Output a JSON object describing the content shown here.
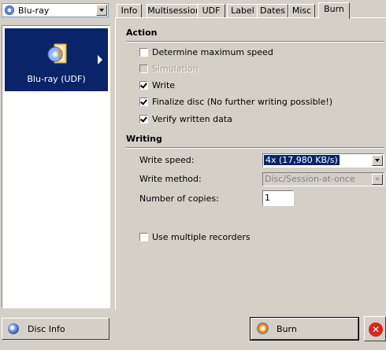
{
  "media": {
    "selected": "Blu-ray"
  },
  "compilation": {
    "item_label": "Blu-ray (UDF)"
  },
  "tabs": [
    {
      "label": "Info"
    },
    {
      "label": "Multisession"
    },
    {
      "label": "UDF"
    },
    {
      "label": "Label"
    },
    {
      "label": "Dates"
    },
    {
      "label": "Misc"
    },
    {
      "label": "Burn"
    }
  ],
  "active_tab": "Burn",
  "action": {
    "title": "Action",
    "options": [
      {
        "label": "Determine maximum speed",
        "checked": false,
        "enabled": true
      },
      {
        "label": "Simulation",
        "checked": false,
        "enabled": false
      },
      {
        "label": "Write",
        "checked": true,
        "enabled": true
      },
      {
        "label": "Finalize disc (No further writing possible!)",
        "checked": true,
        "enabled": true
      },
      {
        "label": "Verify written data",
        "checked": true,
        "enabled": true
      }
    ]
  },
  "writing": {
    "title": "Writing",
    "speed_label": "Write speed:",
    "speed_value": "4x (17,980 KB/s)",
    "method_label": "Write method:",
    "method_value": "Disc/Session-at-once",
    "copies_label": "Number of copies:",
    "copies_value": "1",
    "multiple_recorders_label": "Use multiple recorders",
    "multiple_recorders_checked": false
  },
  "buttons": {
    "disc_info": "Disc Info",
    "burn": "Burn"
  }
}
